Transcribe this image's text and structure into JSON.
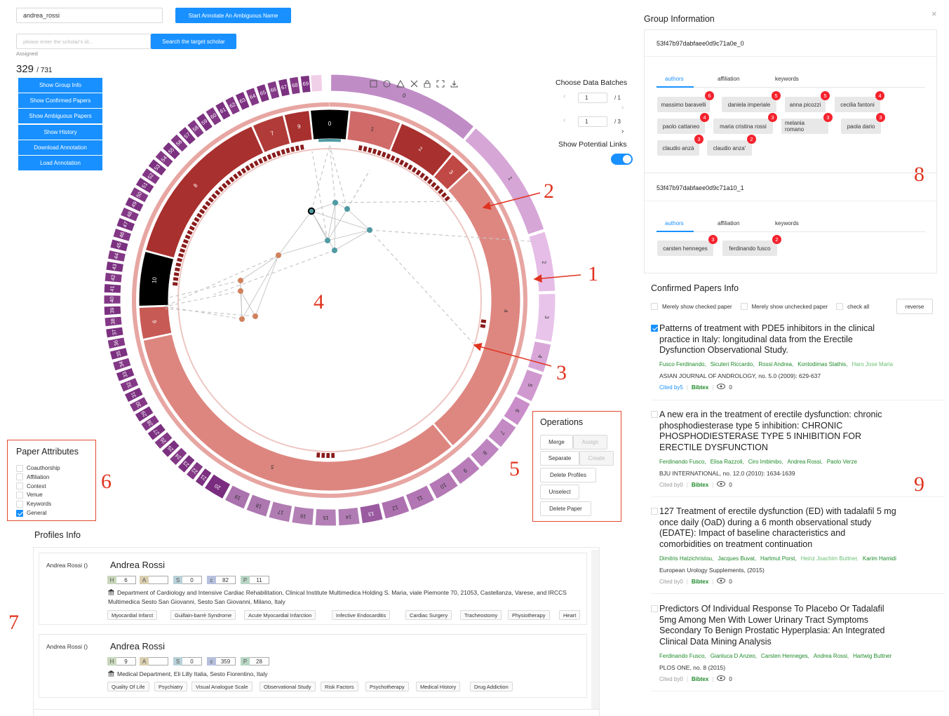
{
  "search": {
    "name_value": "andrea_rossi",
    "start_button": "Start Annotate An Ambiguous Name",
    "id_placeholder": "please enter the scholar's id...",
    "search_button": "Search the target scholar"
  },
  "progress": {
    "label": "Assigned",
    "done": "329",
    "total": "/ 731"
  },
  "menu": [
    "Show Group Info",
    "Show Confirmed Papers",
    "Show Ambiguous Papers",
    "Show History",
    "Download Annotation",
    "Load Annotation"
  ],
  "batches": {
    "title": "Choose Data Batches",
    "b1": {
      "value": "1",
      "total": "/ 1"
    },
    "b2": {
      "value": "1",
      "total": "/ 3"
    },
    "links_label": "Show Potential Links",
    "links_on": true
  },
  "toolbar_icons": [
    "square-select-icon",
    "circle-select-icon",
    "triangle-select-icon",
    "close-icon",
    "lock-icon",
    "fullscreen-icon",
    "download-icon"
  ],
  "ring": {
    "inner_labels": [
      "0",
      "1",
      "2",
      "3",
      "4",
      "5",
      "6",
      "7",
      "8",
      "9",
      "10"
    ],
    "outer_labels": [
      "0",
      "1",
      "2",
      "3",
      "4",
      "5",
      "6",
      "7",
      "8",
      "9",
      "10",
      "11",
      "12",
      "13",
      "14",
      "15",
      "16",
      "17",
      "18",
      "19",
      "20",
      "21",
      "22",
      "23",
      "24",
      "25",
      "26",
      "27",
      "28",
      "29",
      "30",
      "31",
      "32",
      "33",
      "34",
      "35",
      "36",
      "37",
      "38",
      "39",
      "40",
      "41",
      "42",
      "43",
      "44",
      "45",
      "46",
      "47",
      "48",
      "49",
      "50",
      "51",
      "52",
      "53",
      "54",
      "55",
      "56",
      "57",
      "58",
      "59",
      "60",
      "61",
      "62",
      "63",
      "64",
      "65",
      "66",
      "67",
      "68",
      "69",
      "70"
    ],
    "colors": {
      "light": "#e9c2e6",
      "mid": "#c58fc7",
      "dark": "#7a2c7f",
      "red_dark": "#a8302e",
      "red": "#d46a6a",
      "red_light": "#e48a84",
      "black": "#000000",
      "teal": "#4f9aa3",
      "orange": "#d1825d"
    }
  },
  "annotations": [
    "1",
    "2",
    "3",
    "4",
    "5",
    "6",
    "7",
    "8",
    "9"
  ],
  "paper_attributes": {
    "title": "Paper Attributes",
    "items": [
      {
        "label": "Coauthorship",
        "checked": false
      },
      {
        "label": "Affiliation",
        "checked": false
      },
      {
        "label": "Context",
        "checked": false
      },
      {
        "label": "Venue",
        "checked": false
      },
      {
        "label": "Keywords",
        "checked": false
      },
      {
        "label": "General",
        "checked": true
      }
    ]
  },
  "operations": {
    "title": "Operations",
    "merge": "Merge",
    "assign": "Assign",
    "separate": "Separate",
    "create": "Create",
    "delete_profiles": "Delete Profiles",
    "unselect": "Unselect",
    "delete_paper": "Delete Paper"
  },
  "group_info": {
    "title": "Group Information",
    "close": "×",
    "groups": [
      {
        "id": "53f47b97dabfaee0d9c71a0e_0",
        "tabs": [
          "authors",
          "affiliation",
          "keywords"
        ],
        "authors": [
          {
            "name": "massimo baravelli",
            "count": "6"
          },
          {
            "name": "daniela imperiale",
            "count": "5"
          },
          {
            "name": "anna picozzi",
            "count": "5"
          },
          {
            "name": "cecilia fantoni",
            "count": "4"
          },
          {
            "name": "paolo cattaneo",
            "count": "4"
          },
          {
            "name": "maria cristina rossi",
            "count": "3"
          },
          {
            "name": "melania romano",
            "count": "3"
          },
          {
            "name": "paola dario",
            "count": "3"
          },
          {
            "name": "claudio anzà",
            "count": "3"
          },
          {
            "name": "claudio anza'",
            "count": "2"
          }
        ]
      },
      {
        "id": "53f47b97dabfaee0d9c71a10_1",
        "tabs": [
          "authors",
          "affiliation",
          "keywords"
        ],
        "authors": [
          {
            "name": "carsten henneges",
            "count": "3"
          },
          {
            "name": "ferdinando fusco",
            "count": "2"
          }
        ]
      }
    ]
  },
  "confirmed": {
    "title": "Confirmed Papers Info",
    "filters": [
      "Merely show checked paper",
      "Merely show unchecked paper",
      "check all"
    ],
    "reverse": "reverse",
    "papers": [
      {
        "checked": true,
        "title": "Patterns of treatment with PDE5 inhibitors in the clinical practice in Italy: longitudinal data from the Erectile Dysfunction Observational Study.",
        "authors": [
          "Fusco Ferdinando,",
          "Sicuteri Riccardo,",
          "Rossi Andrea,",
          "Kontodimas Stathis,",
          "Haro Jose Maria"
        ],
        "venue": "ASIAN JOURNAL OF ANDROLOGY, no. 5.0 (2009): 629-637",
        "cited": "Cited by5",
        "bibtex": "Bibtex",
        "views": "0"
      },
      {
        "checked": false,
        "title": "A new era in the treatment of erectile dysfunction: chronic phosphodiesterase type 5 inhibition: CHRONIC PHOSPHODIESTERASE TYPE 5 INHIBITION FOR ERECTILE DYSFUNCTION",
        "authors": [
          "Ferdinando Fusco,",
          "Elisa Razzoli,",
          "Ciro Imbimbo,",
          "Andrea Rossi,",
          "Paolo Verze"
        ],
        "venue": "BJU INTERNATIONAL, no. 12.0 (2010): 1634-1639",
        "cited": "Cited by0",
        "bibtex": "Bibtex",
        "views": "0"
      },
      {
        "checked": false,
        "title": "127 Treatment of erectile dysfunction (ED) with tadalafil 5 mg once daily (OaD) during a 6 month observational study (EDATE): Impact of baseline characteristics and comorbidities on treatment continuation",
        "authors": [
          "Dimitris Hatzichristou,",
          "Jacques Buvat,",
          "Hartmut Porst,",
          "Heinz Joachim Buttner,",
          "Karim Hamidi"
        ],
        "venue": "European Urology Supplements, (2015)",
        "cited": "Cited by0",
        "bibtex": "Bibtex",
        "views": "0"
      },
      {
        "checked": false,
        "title": "Predictors Of Individual Response To Placebo Or Tadalafil 5mg Among Men With Lower Urinary Tract Symptoms Secondary To Benign Prostatic Hyperplasia: An Integrated Clinical Data Mining Analysis",
        "authors": [
          "Ferdinando Fusco,",
          "Gianluca D Anzeo,",
          "Carsten Henneges,",
          "Andrea Rossi,",
          "Hartwig Buttner"
        ],
        "venue": "PLOS ONE, no. 8 (2015)",
        "cited": "Cited by0",
        "bibtex": "Bibtex",
        "views": "0"
      }
    ]
  },
  "profiles": {
    "title": "Profiles Info",
    "items": [
      {
        "short": "Andrea Rossi  ()",
        "name": "Andrea Rossi",
        "stats": {
          "H": "6",
          "A": "",
          "S": "0",
          "C": "82",
          "P": "11"
        },
        "affiliation": "Department of Cardiology and Intensive Cardiac Rehabilitation, Clinical Institute Multimedica Holding S. Maria, viale Piemonte 70, 21053, Castellanza, Varese, and IRCCS Multimedica Sesto San Giovanni, Sesto San Giovanni, Milano, Italy",
        "keywords": [
          "Myocardial Infarct",
          "Guillain-barrè Syndrome",
          "Acute Myocardial Infarction",
          "Infective Endocarditis",
          "Cardiac Surgery",
          "Tracheostomy",
          "Physiotherapy",
          "Heart"
        ]
      },
      {
        "short": "Andrea Rossi  ()",
        "name": "Andrea Rossi",
        "stats": {
          "H": "9",
          "A": "",
          "S": "0",
          "C": "359",
          "P": "28"
        },
        "affiliation": "Medical Department, Eli Lilly Italia, Sesto Fiorentino, Italy",
        "keywords": [
          "Quality Of Life",
          "Psychiatry",
          "Visual Analogue Scale",
          "Observational Study",
          "Risk Factors",
          "Psychotherapy",
          "Medical History",
          "Drug Addiction"
        ]
      }
    ]
  }
}
